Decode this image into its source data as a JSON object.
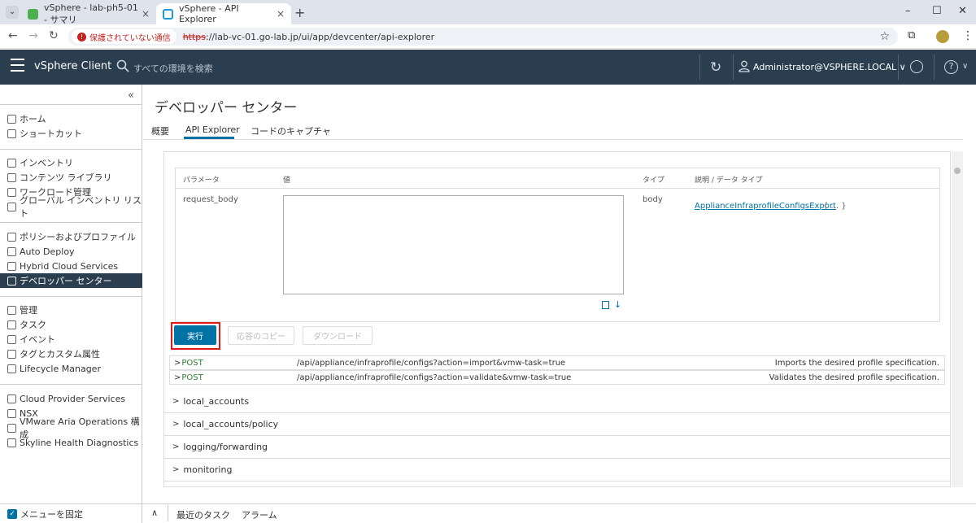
{
  "browser": {
    "tabs": [
      {
        "title": "vSphere - lab-ph5-01 - サマリ",
        "close": "×",
        "active": false
      },
      {
        "title": "vSphere - API Explorer",
        "close": "×",
        "active": true
      }
    ],
    "new_tab": "+",
    "window_controls": {
      "minimize": "–",
      "maximize": "☐",
      "close": "✕"
    },
    "nav": {
      "back": "←",
      "forward": "→",
      "reload": "↻"
    },
    "security_chip": "保護されていない通信",
    "url_scheme": "https",
    "url_rest": "://lab-vc-01.go-lab.jp/ui/app/devcenter/api-explorer",
    "star": "☆",
    "extensions": "⧉",
    "menu": "⋮"
  },
  "header": {
    "app_name": "vSphere Client",
    "search_placeholder": "すべての環境を検索",
    "user": "Administrator@VSPHERE.LOCAL ∨",
    "help": "?"
  },
  "sidebar": {
    "collapse": "«",
    "groups": [
      [
        {
          "label": "ホーム",
          "icon": "home-icon"
        },
        {
          "label": "ショートカット",
          "icon": "shortcut-icon"
        }
      ],
      [
        {
          "label": "インベントリ",
          "icon": "inventory-icon"
        },
        {
          "label": "コンテンツ ライブラリ",
          "icon": "library-icon"
        },
        {
          "label": "ワークロード管理",
          "icon": "workload-icon"
        },
        {
          "label": "グローバル インベントリ リスト",
          "icon": "list-icon"
        }
      ],
      [
        {
          "label": "ポリシーおよびプロファイル",
          "icon": "policy-icon"
        },
        {
          "label": "Auto Deploy",
          "icon": "deploy-icon"
        },
        {
          "label": "Hybrid Cloud Services",
          "icon": "cloud-icon"
        },
        {
          "label": "デベロッパー センター",
          "icon": "code-icon",
          "active": true
        }
      ],
      [
        {
          "label": "管理",
          "icon": "admin-icon"
        },
        {
          "label": "タスク",
          "icon": "tasks-icon"
        },
        {
          "label": "イベント",
          "icon": "events-icon"
        },
        {
          "label": "タグとカスタム属性",
          "icon": "tag-icon"
        },
        {
          "label": "Lifecycle Manager",
          "icon": "lifecycle-icon"
        }
      ],
      [
        {
          "label": "Cloud Provider Services",
          "icon": "cloud-provider-icon"
        },
        {
          "label": "NSX",
          "icon": "nsx-icon"
        },
        {
          "label": "VMware Aria Operations 構成",
          "icon": "aria-icon"
        },
        {
          "label": "Skyline Health Diagnostics",
          "icon": "skyline-icon"
        }
      ]
    ],
    "pin_label": "メニューを固定"
  },
  "main": {
    "title": "デベロッパー センター",
    "tabs": [
      "概要",
      "API Explorer",
      "コードのキャプチャ"
    ],
    "active_tab": "API Explorer",
    "params_table": {
      "headers": [
        "パラメータ",
        "値",
        "タイプ",
        "説明 / データ タイプ"
      ],
      "row": {
        "name": "request_body",
        "value": "",
        "type": "body",
        "schema_link": "ApplianceInfraprofileConfigsExport",
        "schema_suffix": "{ ... }"
      }
    },
    "buttons": {
      "execute": "実行",
      "copy_response": "応答のコピー",
      "download": "ダウンロード"
    },
    "operations": [
      {
        "method": "POST",
        "path": "/api/appliance/infraprofile/configs?action=import&vmw-task=true",
        "desc": "Imports the desired profile specification."
      },
      {
        "method": "POST",
        "path": "/api/appliance/infraprofile/configs?action=validate&vmw-task=true",
        "desc": "Validates the desired profile specification."
      }
    ],
    "groups": [
      "local_accounts",
      "local_accounts/policy",
      "logging/forwarding",
      "monitoring"
    ]
  },
  "bottombar": {
    "chevron": "∧",
    "recent_tasks": "最近のタスク",
    "alarms": "アラーム"
  }
}
